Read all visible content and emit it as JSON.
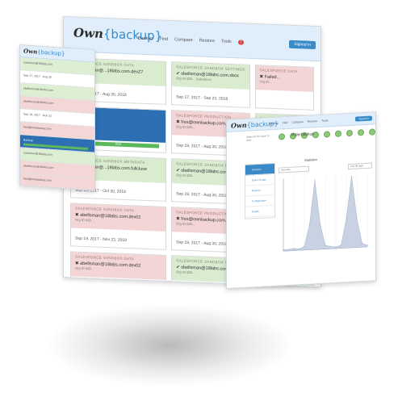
{
  "main": {
    "logo": "Own",
    "logo_bracket": "{backup}",
    "nav": [
      "Backup",
      "Find",
      "Compare",
      "Restore",
      "Tools"
    ],
    "badge": "!",
    "signin": "Signed in",
    "rows": [
      [
        {
          "type": "g",
          "label": "Salesforce Sandbox Data",
          "name": "✔ caertaran@...18labs.com.devZ7",
          "sub": "Org ID 00...",
          "date": "Sep 17, 2017 - Aug 30, 2018"
        },
        {
          "type": "g",
          "label": "Salesforce Sandbox Settings",
          "name": "✔ sbellsman@18labs.com.sbox",
          "sub": "Org ID 00D... Salesforce",
          "date": "Sep 17, 2017 - Sep 23, 2018"
        },
        {
          "type": "r",
          "label": "Salesforce Data",
          "name": "✖ Failed...",
          "sub": "Org ID...",
          "date": ""
        }
      ],
      [
        {
          "type": "blue",
          "label": "",
          "name": "Backup",
          "sub": "",
          "date": "",
          "bar": "85%"
        },
        {
          "type": "r",
          "label": "Salesforce Production",
          "name": "✖ fres@ownbackup.com.sbox",
          "sub": "Org ID 00D...",
          "date": "Sep 19, 2017 - Aug 30, 2018"
        },
        {
          "type": "g",
          "label": "Salesforce Data",
          "name": "✔ ...",
          "sub": "",
          "date": ""
        }
      ],
      [
        {
          "type": "g",
          "label": "Salesforce Sandbox Metadata",
          "name": "✔ caertaran@...18labs.com.fullcluse",
          "sub": "",
          "date": "Sep 19, 2017 - Oct 30, 2018"
        },
        {
          "type": "g",
          "label": "Salesforce Sandbox Data",
          "name": "✔ sbellsman@18labs.com.sbox",
          "sub": "Org ID 00D...",
          "date": "Sep 19, 2017 - Aug 30, 2018"
        },
        {
          "type": "g",
          "label": "",
          "name": "",
          "sub": "",
          "date": ""
        }
      ],
      [
        {
          "type": "r",
          "label": "Salesforce Sandbox Data",
          "name": "✖ abellsman@18labs.com.dev02",
          "sub": "Org ID 00D...",
          "date": "Sep 19, 2017 - Nov 22, 2018"
        },
        {
          "type": "r",
          "label": "Salesforce Production",
          "name": "✖ fres@ownbackup.com.sbox",
          "sub": "Org ID 00D...",
          "date": "Sep 19, 2017 - Aug 30, 2018"
        },
        {
          "type": "r",
          "label": "",
          "name": "",
          "sub": "",
          "date": ""
        }
      ],
      [
        {
          "type": "r",
          "label": "Salesforce Sandbox Data",
          "name": "✖ abellsman@18labs.com.dev02",
          "sub": "Org ID 00D...",
          "date": ""
        },
        {
          "type": "g",
          "label": "Salesforce Sandbox Settings",
          "name": "✔ sbellsman@18labs.com.sbox",
          "sub": "Org ID 00D...",
          "date": ""
        },
        {
          "type": "g",
          "label": "",
          "name": "",
          "sub": "",
          "date": ""
        }
      ]
    ]
  },
  "left": {
    "logo": "Own",
    "logo_bracket": "{backup}",
    "rows": [
      {
        "type": "g",
        "text": "caertaran@18labs.com"
      },
      {
        "type": "w",
        "text": "Sep 17, 2017 - Aug 30"
      },
      {
        "type": "g",
        "text": "sbellsman@18labs.com"
      },
      {
        "type": "r",
        "text": "abellsman@18labs.com"
      },
      {
        "type": "w",
        "text": "Sep 19, 2017 - Nov 22"
      },
      {
        "type": "r",
        "text": "fres@ownbackup.com"
      },
      {
        "type": "b",
        "text": "Backup"
      },
      {
        "type": "g",
        "text": "caertaran@18labs.com"
      },
      {
        "type": "r",
        "text": "abellsman@18labs.com"
      },
      {
        "type": "r",
        "text": "fres@ownbackup.com"
      }
    ]
  },
  "right": {
    "logo": "Own",
    "logo_bracket": "{backup}",
    "nav": [
      "Backup",
      "Find",
      "Compare",
      "Restore",
      "Tools"
    ],
    "signin": "Signed in",
    "status_label": "Status for the past 14 days",
    "title": "Riderbackup",
    "side_items": [
      "Services",
      "Data Lineage",
      "Reports",
      "Configuration",
      "Health"
    ],
    "chart_title": "Statistics",
    "select_left": "Accounts",
    "select_right": "Last 30 days"
  },
  "chart_data": {
    "type": "area",
    "title": "Statistics",
    "xlabel": "",
    "ylabel": "",
    "series": [
      {
        "values": [
          0.02,
          0.02,
          0.03,
          0.02,
          0.05,
          0.35,
          0.95,
          0.35,
          0.05,
          0.03,
          0.02,
          0.04,
          0.4,
          0.98,
          0.4,
          0.05,
          0.02
        ]
      }
    ],
    "ylim": [
      0,
      1
    ],
    "grid": true
  },
  "colors": {
    "brand": "#3a8ac8",
    "ok": "#d9ecd0",
    "fail": "#f3d5d5",
    "primary": "#2d6fb3",
    "progress": "#5cb85c"
  }
}
